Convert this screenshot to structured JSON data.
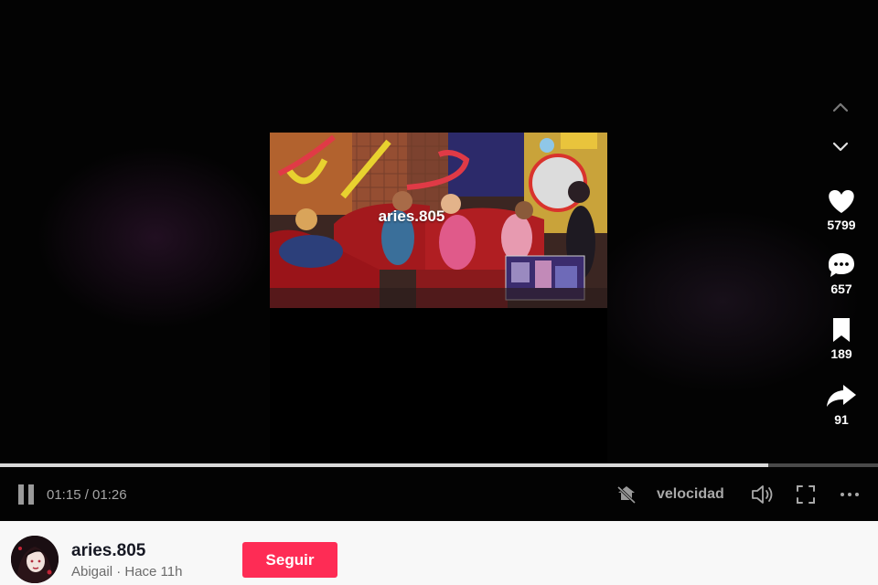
{
  "video": {
    "watermark": "aries.805"
  },
  "actions": {
    "likes": "5799",
    "comments": "657",
    "saves": "189",
    "shares": "91"
  },
  "player": {
    "progress": 0.875,
    "current_time": "01:15",
    "duration": "01:26",
    "time_display": "01:15 / 01:26",
    "speed_label": "velocidad"
  },
  "author": {
    "username": "aries.805",
    "display_name": "Abigail",
    "posted": "Hace 11h",
    "follow_label": "Seguir"
  },
  "colors": {
    "follow_button": "#fe2c55",
    "background": "#000000",
    "author_bar": "#f8f8f8"
  },
  "icons": [
    "chevron-up-icon",
    "chevron-down-icon",
    "heart-icon",
    "comment-icon",
    "bookmark-icon",
    "share-icon",
    "pause-icon",
    "no-pip-icon",
    "volume-icon",
    "fullscreen-icon",
    "more-icon"
  ]
}
